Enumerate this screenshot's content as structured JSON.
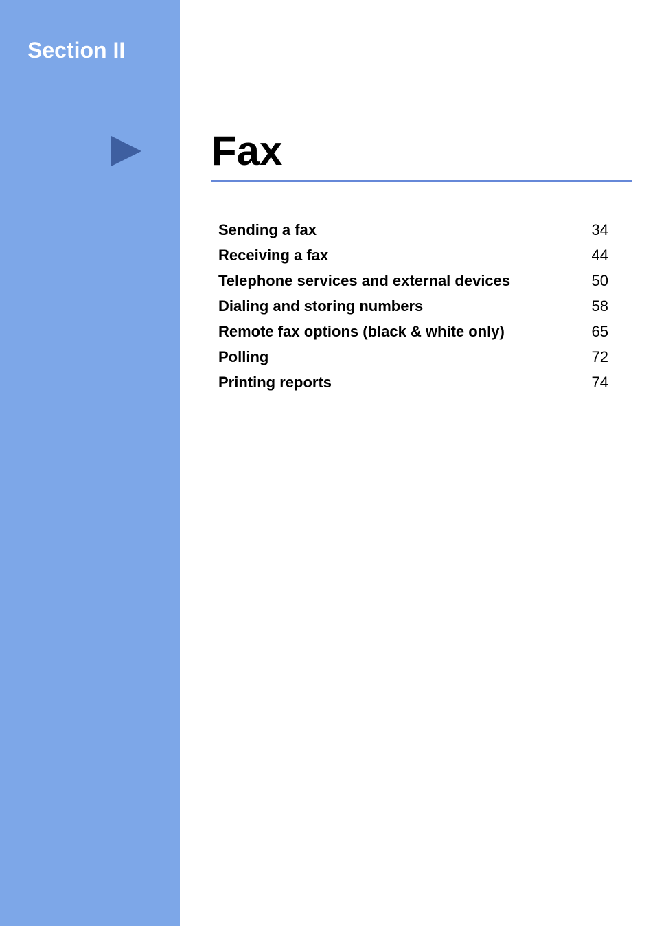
{
  "section_label": "Section II",
  "main_title": "Fax",
  "toc": [
    {
      "title": "Sending a fax",
      "page": "34"
    },
    {
      "title": "Receiving a fax",
      "page": "44"
    },
    {
      "title": "Telephone services and external devices",
      "page": "50"
    },
    {
      "title": "Dialing and storing numbers",
      "page": "58"
    },
    {
      "title": "Remote fax options  (black & white only)",
      "page": "65"
    },
    {
      "title": "Polling",
      "page": "72"
    },
    {
      "title": "Printing reports",
      "page": "74"
    }
  ]
}
